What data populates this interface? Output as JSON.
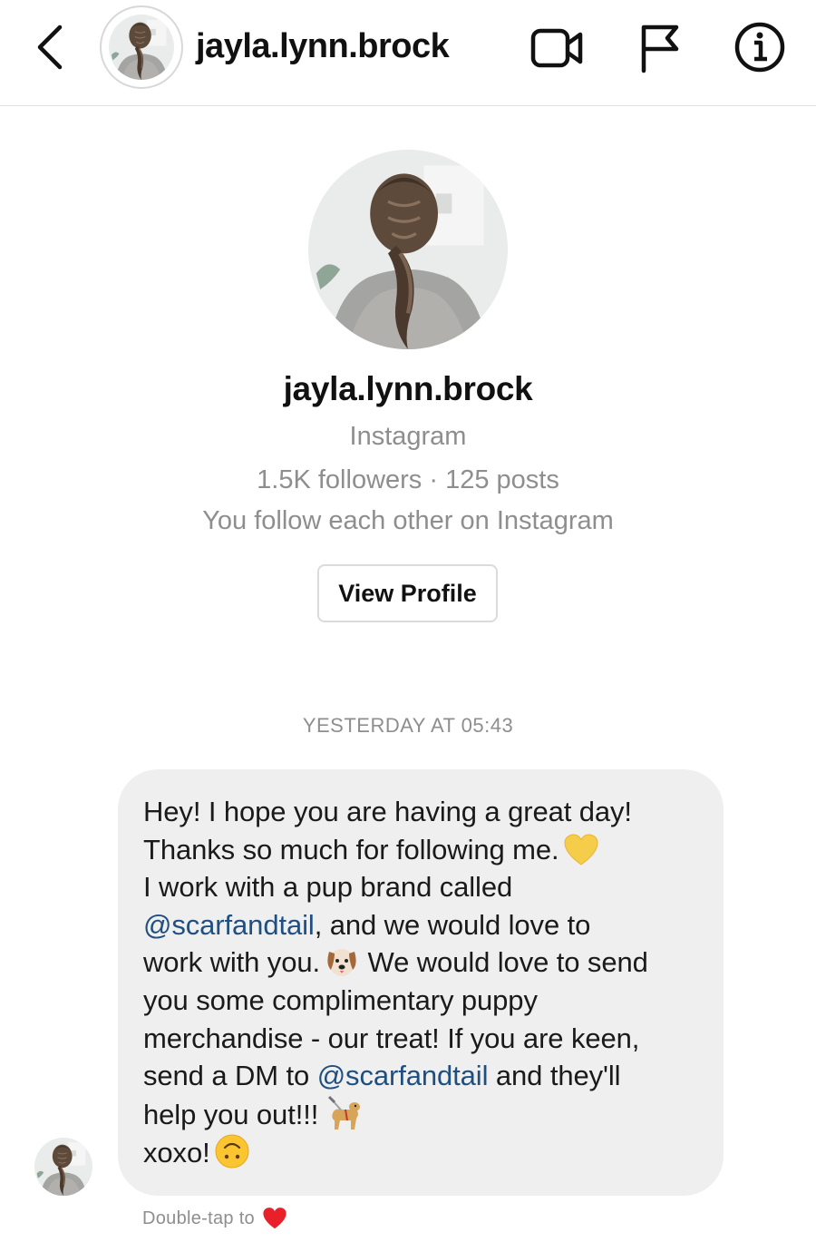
{
  "header": {
    "username": "jayla.lynn.brock",
    "icons": [
      "back-chevron-icon",
      "video-call-icon",
      "report-flag-icon",
      "info-icon"
    ]
  },
  "profile": {
    "name": "jayla.lynn.brock",
    "platform": "Instagram",
    "stats": "1.5K followers · 125 posts",
    "mutual": "You follow each other on Instagram",
    "view_profile_label": "View Profile"
  },
  "conversation": {
    "timestamp": "YESTERDAY AT 05:43",
    "message": {
      "l1": "Hey! I hope you are having a great day!",
      "l2": "Thanks so much for following me.",
      "l3": "I work with a pup brand called",
      "mention1": "@scarfandtail",
      "l4_rest": ", and we would love  to",
      "l5": "work with you.",
      "l5_rest": " We would love to send",
      "l6": "you some complimentary puppy",
      "l7": "merchandise - our treat! If you are keen,",
      "l8_pre": "send a DM to ",
      "mention2": "@scarfandtail",
      "l8_rest": " and they'll",
      "l9": "help you out!!!",
      "l10": "xoxo!",
      "emojis": [
        "yellow-heart-emoji",
        "dog-face-emoji",
        "guide-dog-emoji",
        "upside-down-face-emoji"
      ]
    },
    "hint_text": "Double-tap to",
    "hint_icon": "red-heart-emoji"
  },
  "colors": {
    "mention": "#1f4f80",
    "secondary_text": "#8e8e8e",
    "bubble": "#efefef",
    "heart": "#e8202a"
  }
}
